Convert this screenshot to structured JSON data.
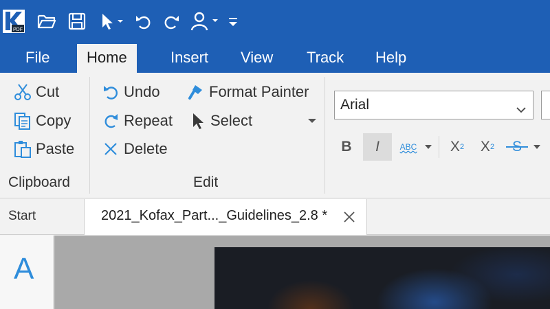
{
  "titlebar": {
    "app_name": "Kofax Power PDF",
    "quick_access_icons": [
      "folder-open-icon",
      "save-icon",
      "cursor-select-icon",
      "undo-icon",
      "redo-icon",
      "user-icon",
      "customize-icon"
    ]
  },
  "ribbon_tabs": [
    {
      "label": "File"
    },
    {
      "label": "Home",
      "active": true
    },
    {
      "label": "Insert"
    },
    {
      "label": "View"
    },
    {
      "label": "Track"
    },
    {
      "label": "Help"
    }
  ],
  "ribbon": {
    "clipboard": {
      "label": "Clipboard",
      "cut": "Cut",
      "copy": "Copy",
      "paste": "Paste"
    },
    "edit": {
      "label": "Edit",
      "undo": "Undo",
      "repeat": "Repeat",
      "delete": "Delete",
      "format_painter": "Format Painter",
      "select": "Select"
    },
    "font": {
      "family": "Arial",
      "bold": "B",
      "italic": "I",
      "spell": "ABC",
      "superscript": "X",
      "subscript": "X",
      "strikethrough": "S"
    }
  },
  "document_tabs": {
    "start": "Start",
    "active_doc": "2021_Kofax_Part..._Guidelines_2.8 *"
  },
  "side_panel": {
    "icon_letter": "A"
  },
  "colors": {
    "titlebar": "#1e5fb5",
    "ribbon_bg": "#f2f2f2",
    "icon_blue": "#2f8ddb"
  }
}
